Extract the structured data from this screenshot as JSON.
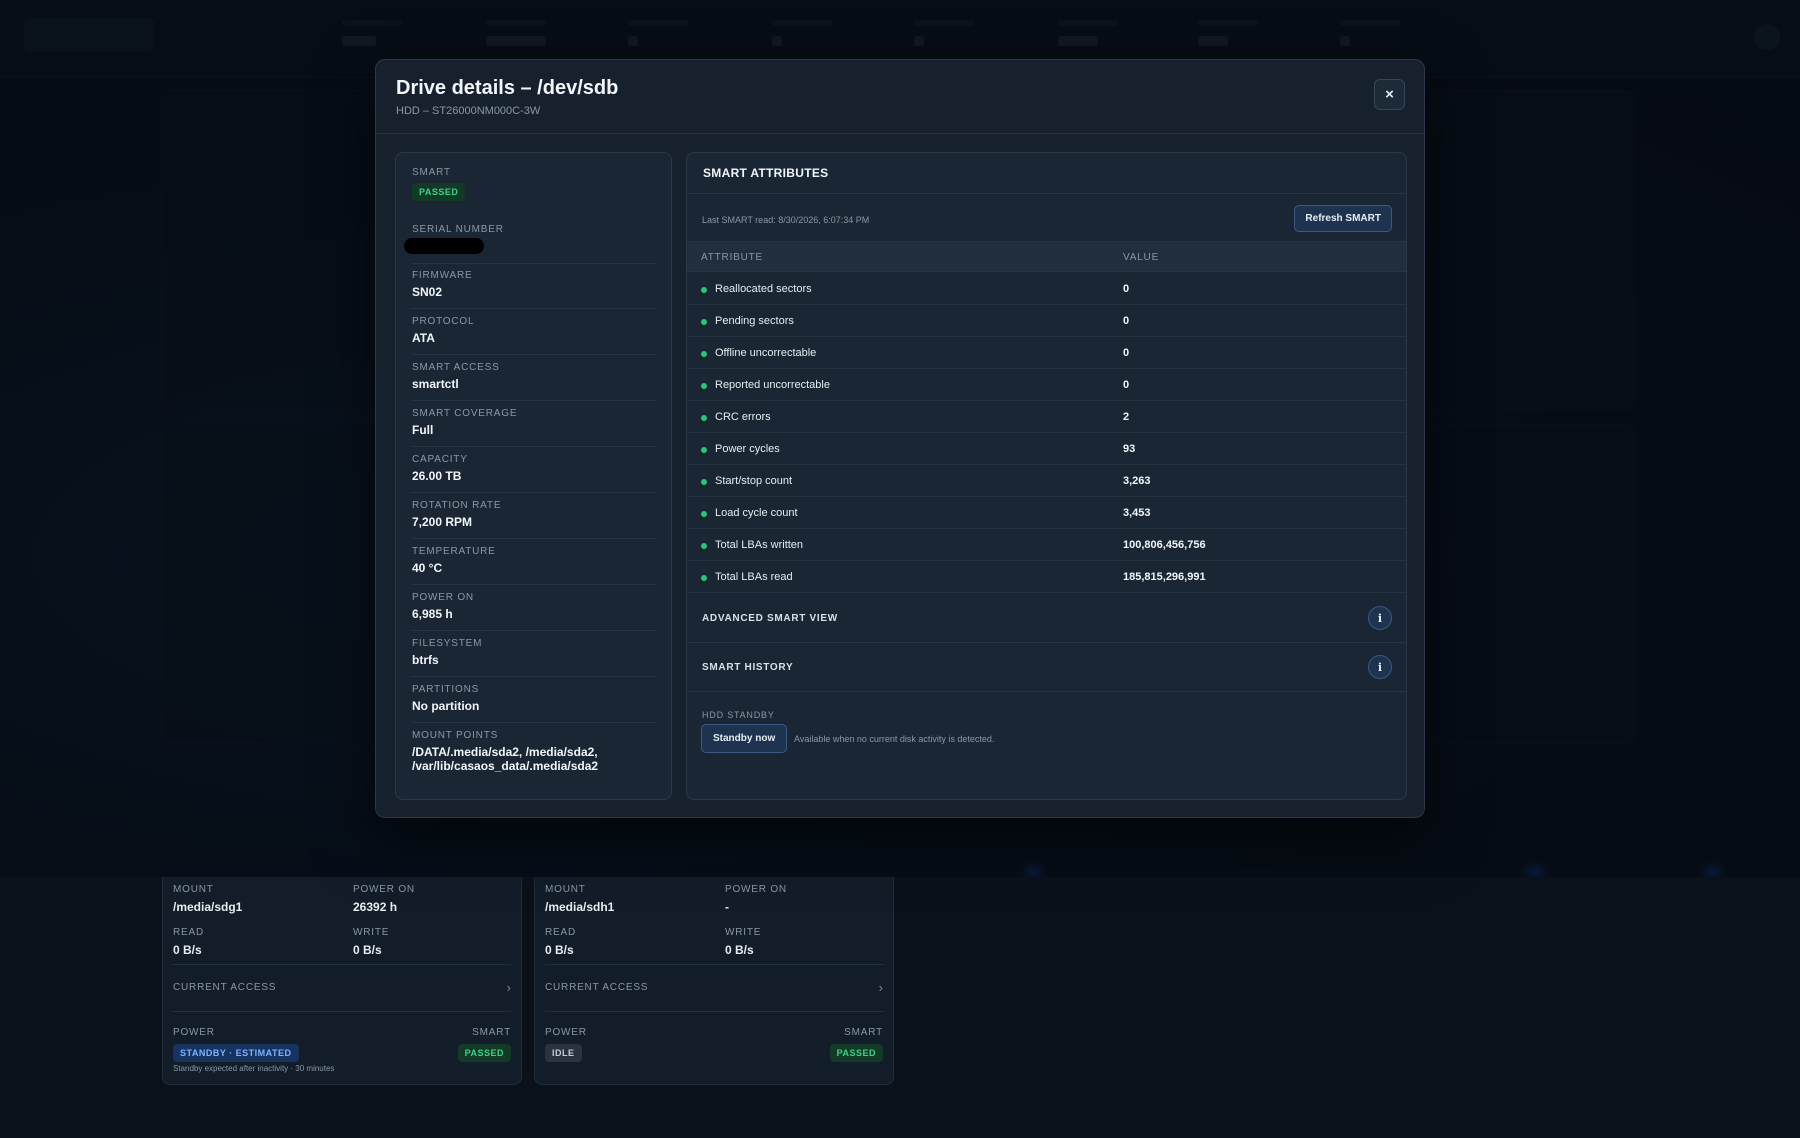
{
  "modal": {
    "title": "Drive details – /dev/sdb",
    "subtitle": "HDD – ST26000NM000C-3W",
    "close_label": "×"
  },
  "info": {
    "smart_label": "SMART",
    "smart_status": "PASSED",
    "serial_label": "SERIAL NUMBER",
    "fields": [
      {
        "label": "FIRMWARE",
        "value": "SN02"
      },
      {
        "label": "PROTOCOL",
        "value": "ATA"
      },
      {
        "label": "SMART ACCESS",
        "value": "smartctl"
      },
      {
        "label": "SMART COVERAGE",
        "value": "Full"
      },
      {
        "label": "CAPACITY",
        "value": "26.00 TB"
      },
      {
        "label": "ROTATION RATE",
        "value": "7,200 RPM"
      },
      {
        "label": "TEMPERATURE",
        "value": "40 °C"
      },
      {
        "label": "POWER ON",
        "value": "6,985 h"
      },
      {
        "label": "FILESYSTEM",
        "value": "btrfs"
      },
      {
        "label": "PARTITIONS",
        "value": "No partition"
      }
    ],
    "mount_label": "MOUNT POINTS",
    "mount_line1": "/DATA/.media/sda2, /media/sda2,",
    "mount_line2": "/var/lib/casaos_data/.media/sda2"
  },
  "smart": {
    "title": "SMART ATTRIBUTES",
    "last_read": "Last SMART read: 8/30/2026, 6:07:34 PM",
    "refresh_label": "Refresh SMART",
    "col_attribute": "ATTRIBUTE",
    "col_value": "VALUE",
    "status_color": "#2fc37a",
    "rows": [
      {
        "name": "Reallocated sectors",
        "value": "0"
      },
      {
        "name": "Pending sectors",
        "value": "0"
      },
      {
        "name": "Offline uncorrectable",
        "value": "0"
      },
      {
        "name": "Reported uncorrectable",
        "value": "0"
      },
      {
        "name": "CRC errors",
        "value": "2"
      },
      {
        "name": "Power cycles",
        "value": "93"
      },
      {
        "name": "Start/stop count",
        "value": "3,263"
      },
      {
        "name": "Load cycle count",
        "value": "3,453"
      },
      {
        "name": "Total LBAs written",
        "value": "100,806,456,756"
      },
      {
        "name": "Total LBAs read",
        "value": "185,815,296,991"
      }
    ],
    "advanced_label": "ADVANCED SMART VIEW",
    "history_label": "SMART HISTORY",
    "info_glyph": "i",
    "standby_label": "HDD STANDBY",
    "standby_button": "Standby now",
    "standby_note": "Available when no current disk activity is detected."
  },
  "cards": [
    {
      "mount_label": "MOUNT",
      "mount": "/media/sdg1",
      "power_on_label": "POWER ON",
      "power_on": "26392 h",
      "read_label": "READ",
      "read": "0 B/s",
      "write_label": "WRITE",
      "write": "0 B/s",
      "access_label": "CURRENT ACCESS",
      "power_label": "POWER",
      "power_state": "STANDBY · ESTIMATED",
      "smart_label": "SMART",
      "smart_state": "PASSED",
      "note": "Standby expected after inactivity · 30 minutes"
    },
    {
      "mount_label": "MOUNT",
      "mount": "/media/sdh1",
      "power_on_label": "POWER ON",
      "power_on": "-",
      "read_label": "READ",
      "read": "0 B/s",
      "write_label": "WRITE",
      "write": "0 B/s",
      "access_label": "CURRENT ACCESS",
      "power_label": "POWER",
      "power_state": "IDLE",
      "smart_label": "SMART",
      "smart_state": "PASSED",
      "note": ""
    }
  ]
}
